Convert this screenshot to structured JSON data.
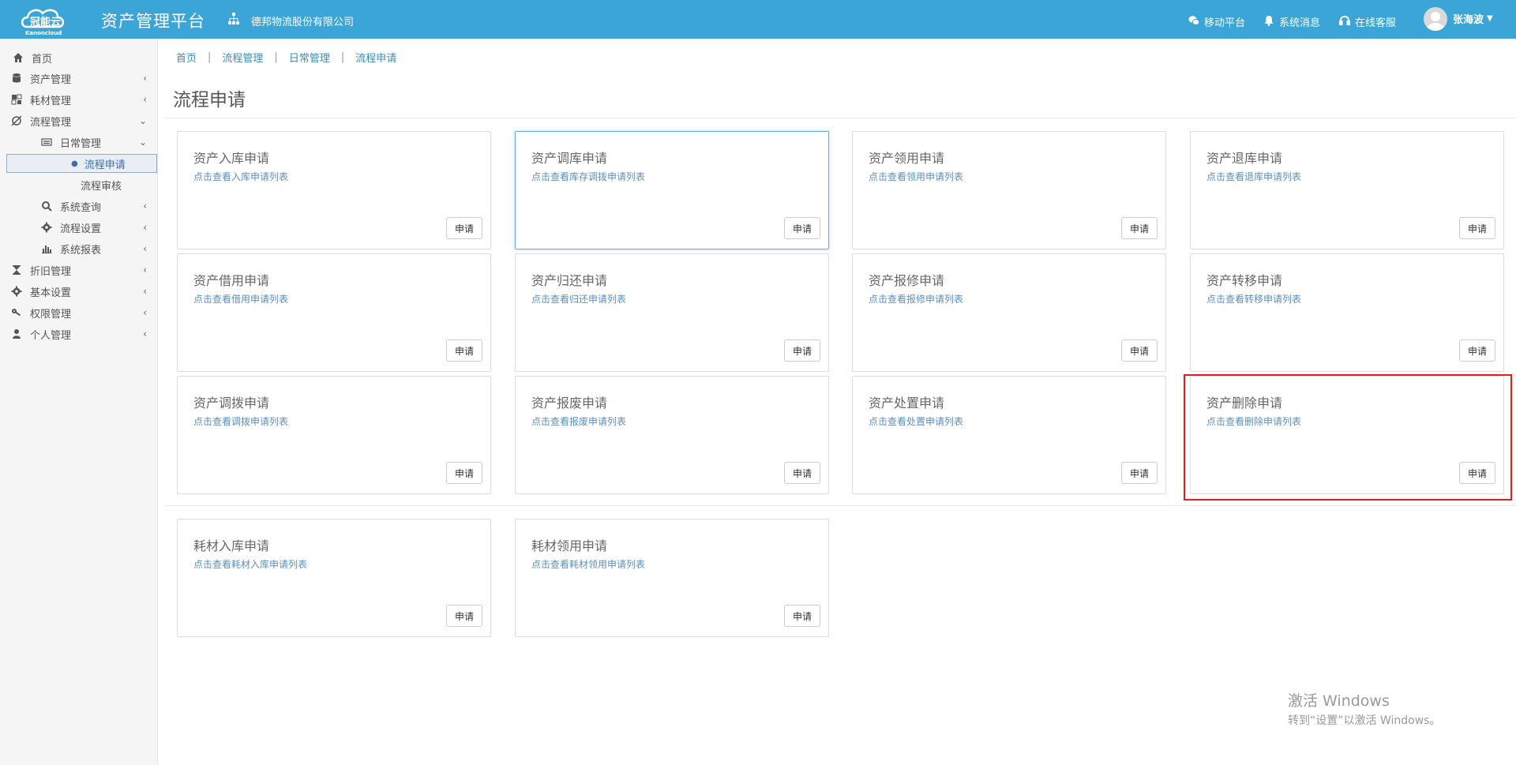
{
  "header": {
    "logo_text": "冠能云 Kanoncloud",
    "app_title": "资产管理平台",
    "org_name": "德邦物流股份有限公司",
    "links": {
      "mobile": "移动平台",
      "messages": "系统消息",
      "support": "在线客服"
    },
    "user_name": "张海波"
  },
  "sidebar": {
    "items": [
      {
        "label": "首页"
      },
      {
        "label": "资产管理"
      },
      {
        "label": "耗材管理"
      },
      {
        "label": "流程管理"
      },
      {
        "label": "日常管理"
      },
      {
        "label": "流程申请"
      },
      {
        "label": "流程审核"
      },
      {
        "label": "系统查询"
      },
      {
        "label": "流程设置"
      },
      {
        "label": "系统报表"
      },
      {
        "label": "折旧管理"
      },
      {
        "label": "基本设置"
      },
      {
        "label": "权限管理"
      },
      {
        "label": "个人管理"
      }
    ]
  },
  "breadcrumb": [
    "首页",
    "流程管理",
    "日常管理",
    "流程申请"
  ],
  "page_title": "流程申请",
  "button_label": "申请",
  "cards": [
    {
      "title": "资产入库申请",
      "desc": "点击查看入库申请列表"
    },
    {
      "title": "资产调库申请",
      "desc": "点击查看库存调拨申请列表"
    },
    {
      "title": "资产领用申请",
      "desc": "点击查看领用申请列表"
    },
    {
      "title": "资产退库申请",
      "desc": "点击查看退库申请列表"
    },
    {
      "title": "资产借用申请",
      "desc": "点击查看借用申请列表"
    },
    {
      "title": "资产归还申请",
      "desc": "点击查看归还申请列表"
    },
    {
      "title": "资产报修申请",
      "desc": "点击查看报修申请列表"
    },
    {
      "title": "资产转移申请",
      "desc": "点击查看转移申请列表"
    },
    {
      "title": "资产调拨申请",
      "desc": "点击查看调拨申请列表"
    },
    {
      "title": "资产报废申请",
      "desc": "点击查看报废申请列表"
    },
    {
      "title": "资产处置申请",
      "desc": "点击查看处置申请列表"
    },
    {
      "title": "资产删除申请",
      "desc": "点击查看删除申请列表"
    },
    {
      "title": "耗材入库申请",
      "desc": "点击查看耗材入库申请列表"
    },
    {
      "title": "耗材领用申请",
      "desc": "点击查看耗材领用申请列表"
    }
  ],
  "watermark": {
    "title": "激活 Windows",
    "subtitle": "转到“设置”以激活 Windows。"
  },
  "colors": {
    "header_bg": "#3ca5d8",
    "highlight": "#e02020",
    "link": "#3c8dbc"
  }
}
